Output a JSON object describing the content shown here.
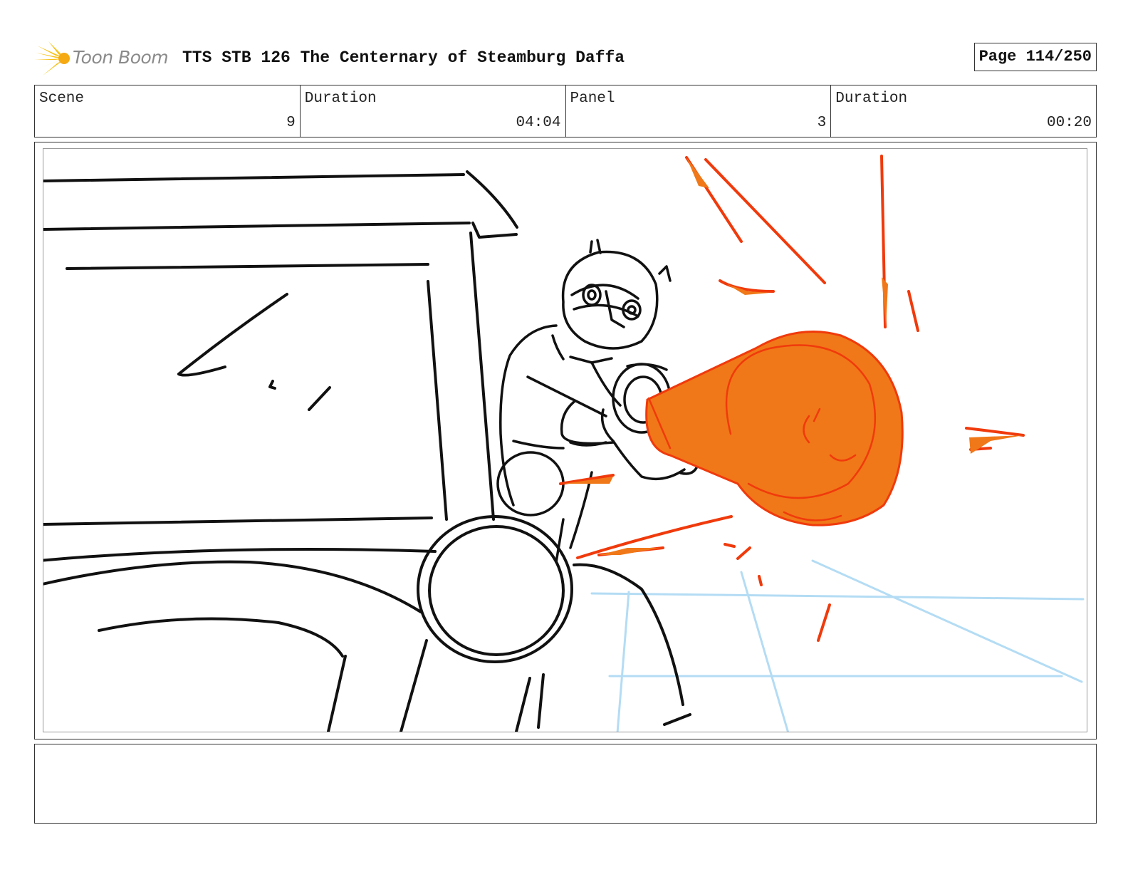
{
  "header": {
    "logo_text": "Toon Boom",
    "logo_icon": "starburst-logo-icon",
    "title": "TTS STB 126 The Centernary of Steamburg Daffa",
    "page": "Page 114/250"
  },
  "info": {
    "scene_label": "Scene",
    "scene_value": "9",
    "scene_duration_label": "Duration",
    "scene_duration_value": "04:04",
    "panel_label": "Panel",
    "panel_value": "3",
    "panel_duration_label": "Duration",
    "panel_duration_value": "00:20"
  },
  "colors": {
    "ink": "#111111",
    "fx_orange": "#f07818",
    "fx_red": "#f03a0c",
    "guide_blue": "#b4dcf4",
    "logo_yellow": "#f7c21a"
  }
}
